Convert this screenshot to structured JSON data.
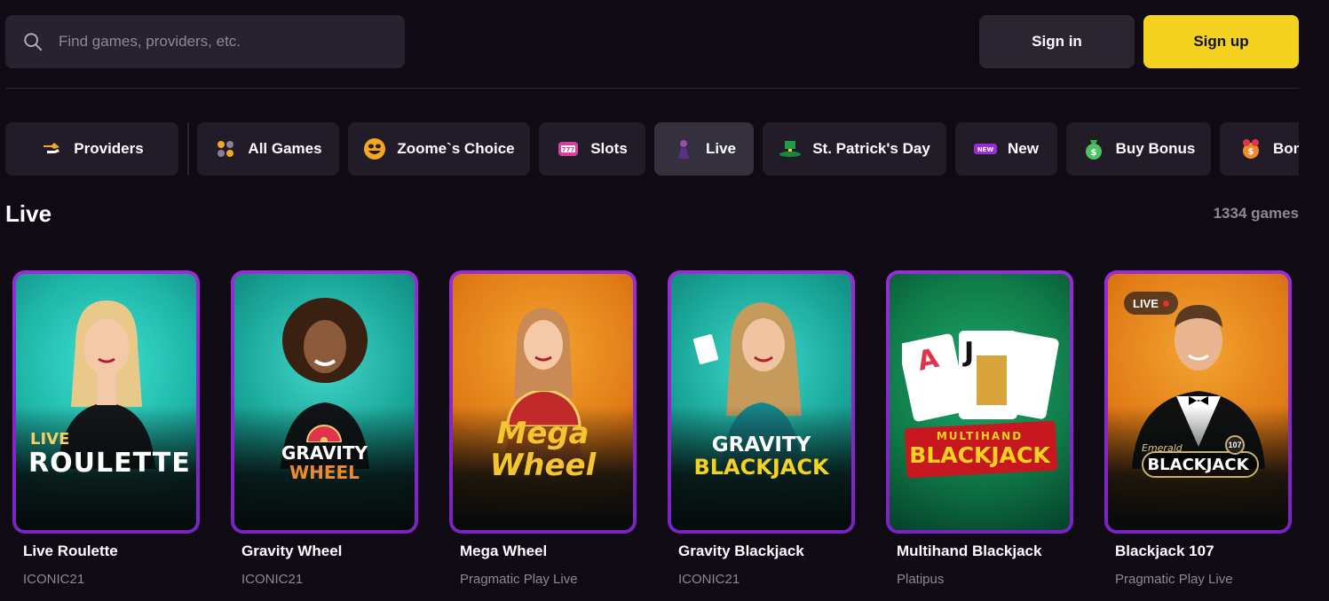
{
  "search": {
    "placeholder": "Find games, providers, etc."
  },
  "auth": {
    "signin_label": "Sign in",
    "signup_label": "Sign up"
  },
  "categories": [
    {
      "label": "Providers",
      "icon": "providers-icon"
    },
    {
      "label": "All Games",
      "icon": "grid-dots-icon"
    },
    {
      "label": "Zoome`s Choice",
      "icon": "smiley-icon"
    },
    {
      "label": "Slots",
      "icon": "slot-machine-icon"
    },
    {
      "label": "Live",
      "icon": "live-dealer-icon",
      "active": true
    },
    {
      "label": "St. Patrick's Day",
      "icon": "leprechaun-hat-icon"
    },
    {
      "label": "New",
      "icon": "new-badge-icon",
      "badge": "NEW"
    },
    {
      "label": "Buy Bonus",
      "icon": "money-bag-icon"
    },
    {
      "label": "Bon",
      "icon": "gift-icon"
    }
  ],
  "section": {
    "title": "Live",
    "count": "1334 games"
  },
  "games": [
    {
      "title": "Live Roulette",
      "provider": "ICONIC21",
      "logo_line1": "LIVE",
      "logo_line2": "ROULETTE"
    },
    {
      "title": "Gravity Wheel",
      "provider": "ICONIC21",
      "logo_line1": "GRAVITY",
      "logo_line2": "WHEEL"
    },
    {
      "title": "Mega Wheel",
      "provider": "Pragmatic Play Live",
      "logo_line1": "Mega",
      "logo_line2": "Wheel"
    },
    {
      "title": "Gravity Blackjack",
      "provider": "ICONIC21",
      "logo_line1": "GRAVITY",
      "logo_line2": "BLACKJACK"
    },
    {
      "title": "Multihand Blackjack",
      "provider": "Platipus",
      "logo_line1": "MULTIHAND",
      "logo_line2": "BLACKJACK"
    },
    {
      "title": "Blackjack 107",
      "provider": "Pragmatic Play Live",
      "logo_line1": "Emerald",
      "logo_line2": "BLACKJACK",
      "badge": "LIVE",
      "table_no": "107"
    }
  ],
  "colors": {
    "background": "#0f0a13",
    "accent": "#f5d21f",
    "card_border": "#9b2bd8",
    "muted_text": "#8d8797"
  }
}
